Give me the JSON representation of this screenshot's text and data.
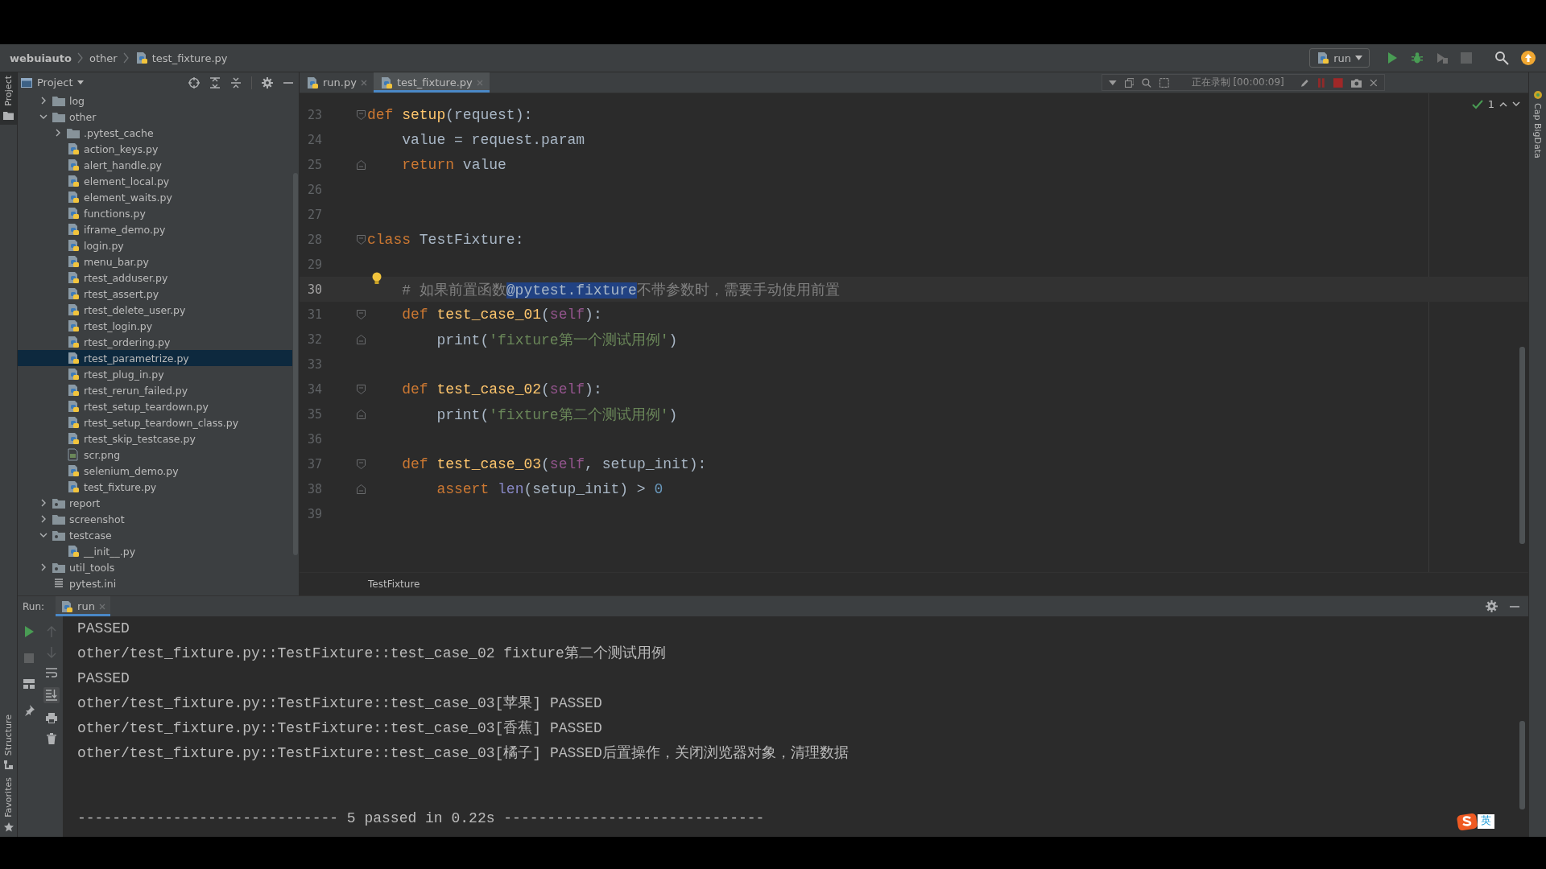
{
  "navbar": {
    "breadcrumbs": [
      "webuiauto",
      "other",
      "test_fixture.py"
    ],
    "run_config": "run"
  },
  "left_stripe": {
    "top": [
      {
        "label": "Project",
        "kind": "project",
        "selected": true
      }
    ],
    "bottom": [
      {
        "label": "Structure",
        "kind": "structure",
        "selected": false
      },
      {
        "label": "Favorites",
        "kind": "favorites",
        "selected": false
      }
    ]
  },
  "right_stripe": {
    "label": "Cap BigData"
  },
  "project_panel": {
    "title": "Project",
    "tree": [
      {
        "name": "log",
        "kind": "folder",
        "expanded": false,
        "selected": false
      },
      {
        "name": "other",
        "kind": "folder",
        "expanded": true,
        "selected": false,
        "children": [
          {
            "name": ".pytest_cache",
            "kind": "folder",
            "expanded": false,
            "selected": false
          },
          {
            "name": "action_keys.py",
            "kind": "python",
            "selected": false
          },
          {
            "name": "alert_handle.py",
            "kind": "python",
            "selected": false
          },
          {
            "name": "element_local.py",
            "kind": "python",
            "selected": false
          },
          {
            "name": "element_waits.py",
            "kind": "python",
            "selected": false
          },
          {
            "name": "functions.py",
            "kind": "python",
            "selected": false
          },
          {
            "name": "iframe_demo.py",
            "kind": "python",
            "selected": false
          },
          {
            "name": "login.py",
            "kind": "python",
            "selected": false
          },
          {
            "name": "menu_bar.py",
            "kind": "python",
            "selected": false
          },
          {
            "name": "rtest_adduser.py",
            "kind": "python",
            "selected": false
          },
          {
            "name": "rtest_assert.py",
            "kind": "python",
            "selected": false
          },
          {
            "name": "rtest_delete_user.py",
            "kind": "python",
            "selected": false
          },
          {
            "name": "rtest_login.py",
            "kind": "python",
            "selected": false
          },
          {
            "name": "rtest_ordering.py",
            "kind": "python",
            "selected": false
          },
          {
            "name": "rtest_parametrize.py",
            "kind": "python",
            "selected": true
          },
          {
            "name": "rtest_plug_in.py",
            "kind": "python",
            "selected": false
          },
          {
            "name": "rtest_rerun_failed.py",
            "kind": "python",
            "selected": false
          },
          {
            "name": "rtest_setup_teardown.py",
            "kind": "python",
            "selected": false
          },
          {
            "name": "rtest_setup_teardown_class.py",
            "kind": "python",
            "selected": false
          },
          {
            "name": "rtest_skip_testcase.py",
            "kind": "python",
            "selected": false
          },
          {
            "name": "scr.png",
            "kind": "image",
            "selected": false
          },
          {
            "name": "selenium_demo.py",
            "kind": "python",
            "selected": false
          },
          {
            "name": "test_fixture.py",
            "kind": "python",
            "selected": false
          }
        ]
      },
      {
        "name": "report",
        "kind": "package",
        "expanded": false,
        "selected": false
      },
      {
        "name": "screenshot",
        "kind": "folder",
        "expanded": false,
        "selected": false
      },
      {
        "name": "testcase",
        "kind": "package",
        "expanded": true,
        "selected": false,
        "children": [
          {
            "name": "__init__.py",
            "kind": "python",
            "selected": false
          }
        ]
      },
      {
        "name": "util_tools",
        "kind": "package",
        "expanded": false,
        "selected": false
      },
      {
        "name": "pytest.ini",
        "kind": "ini",
        "selected": false
      }
    ]
  },
  "editor": {
    "tabs": [
      {
        "label": "run.py",
        "selected": false
      },
      {
        "label": "test_fixture.py",
        "selected": true
      }
    ],
    "recording": {
      "text": "正在录制 [00:00:09]"
    },
    "inspection": {
      "count": "1"
    },
    "lines": [
      {
        "number": "23",
        "kind": "opener",
        "current": false,
        "tokens": [
          {
            "text": "def ",
            "kind": "keyword"
          },
          {
            "text": "setup",
            "kind": "function"
          },
          {
            "text": "(request):",
            "kind": "plain"
          }
        ]
      },
      {
        "number": "24",
        "kind": "body",
        "current": false,
        "tokens": [
          {
            "text": "    value = request.param",
            "kind": "plain"
          }
        ]
      },
      {
        "number": "25",
        "kind": "closer",
        "current": false,
        "tokens": [
          {
            "text": "    return ",
            "kind": "keyword"
          },
          {
            "text": "value",
            "kind": "plain"
          }
        ]
      },
      {
        "number": "26",
        "kind": "body",
        "current": false
      },
      {
        "number": "27",
        "kind": "body",
        "current": false
      },
      {
        "number": "28",
        "kind": "opener",
        "current": false,
        "tokens": [
          {
            "text": "class ",
            "kind": "keyword"
          },
          {
            "text": "TestFixture:",
            "kind": "plain"
          }
        ]
      },
      {
        "number": "29",
        "kind": "body",
        "current": false
      },
      {
        "number": "30",
        "kind": "body",
        "current": true,
        "tokens": [
          {
            "text": "    # 如果前置函数",
            "kind": "comment"
          },
          {
            "text": "@pytest.fixture",
            "kind": "selected"
          },
          {
            "text": "不带参数时，需要手动使用前置",
            "kind": "comment"
          }
        ]
      },
      {
        "number": "31",
        "kind": "opener",
        "current": false,
        "tokens": [
          {
            "text": "    def ",
            "kind": "keyword"
          },
          {
            "text": "test_case_01",
            "kind": "function"
          },
          {
            "text": "(",
            "kind": "plain"
          },
          {
            "text": "self",
            "kind": "self"
          },
          {
            "text": "):",
            "kind": "plain"
          }
        ]
      },
      {
        "number": "32",
        "kind": "closer",
        "current": false,
        "tokens": [
          {
            "text": "        print(",
            "kind": "plain"
          },
          {
            "text": "'fixture第一个测试用例'",
            "kind": "string"
          },
          {
            "text": ")",
            "kind": "plain"
          }
        ]
      },
      {
        "number": "33",
        "kind": "body",
        "current": false
      },
      {
        "number": "34",
        "kind": "opener",
        "current": false,
        "tokens": [
          {
            "text": "    def ",
            "kind": "keyword"
          },
          {
            "text": "test_case_02",
            "kind": "function"
          },
          {
            "text": "(",
            "kind": "plain"
          },
          {
            "text": "self",
            "kind": "self"
          },
          {
            "text": "):",
            "kind": "plain"
          }
        ]
      },
      {
        "number": "35",
        "kind": "closer",
        "current": false,
        "tokens": [
          {
            "text": "        print(",
            "kind": "plain"
          },
          {
            "text": "'fixture第二个测试用例'",
            "kind": "string"
          },
          {
            "text": ")",
            "kind": "plain"
          }
        ]
      },
      {
        "number": "36",
        "kind": "body",
        "current": false
      },
      {
        "number": "37",
        "kind": "opener",
        "current": false,
        "tokens": [
          {
            "text": "    def ",
            "kind": "keyword"
          },
          {
            "text": "test_case_03",
            "kind": "function"
          },
          {
            "text": "(",
            "kind": "plain"
          },
          {
            "text": "self",
            "kind": "self"
          },
          {
            "text": ", setup_init):",
            "kind": "plain"
          }
        ]
      },
      {
        "number": "38",
        "kind": "closer",
        "current": false,
        "tokens": [
          {
            "text": "        assert ",
            "kind": "keyword"
          },
          {
            "text": "len",
            "kind": "builtin"
          },
          {
            "text": "(setup_init) > ",
            "kind": "plain"
          },
          {
            "text": "0",
            "kind": "number"
          }
        ]
      },
      {
        "number": "39",
        "kind": "body",
        "current": false
      }
    ],
    "breadcrumb": "TestFixture"
  },
  "run_panel": {
    "label": "Run:",
    "tabs": [
      {
        "label": "run",
        "selected": true
      }
    ],
    "output": [
      "PASSED",
      "other/test_fixture.py::TestFixture::test_case_02 fixture第二个测试用例",
      "PASSED",
      "other/test_fixture.py::TestFixture::test_case_03[苹果] PASSED",
      "other/test_fixture.py::TestFixture::test_case_03[香蕉] PASSED",
      "other/test_fixture.py::TestFixture::test_case_03[橘子] PASSED后置操作，关闭浏览器对象，清理数据"
    ],
    "summary": "------------------------------ 5 passed in 0.22s ------------------------------"
  },
  "ime": {
    "label": "英"
  }
}
